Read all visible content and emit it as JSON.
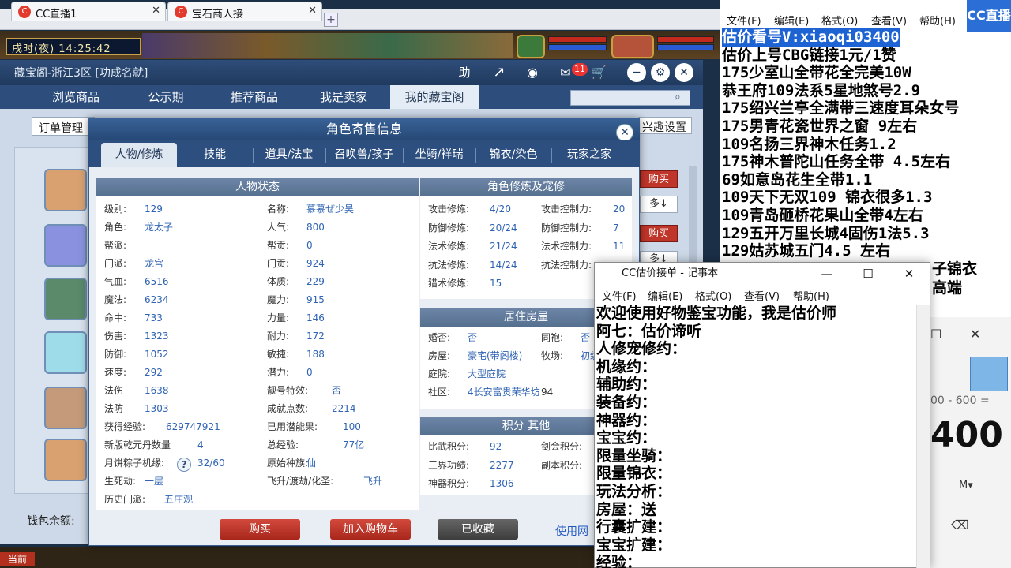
{
  "browser": {
    "tabs": [
      {
        "label": "CC直播1",
        "close": "✕"
      },
      {
        "label": "宝石商人接",
        "close": "✕"
      }
    ],
    "new_tab": "+"
  },
  "game": {
    "clock": "戌时(夜) 14:25:42",
    "window_title": "藏宝阁-浙江3区 [功成名就]",
    "titlebar": {
      "help_label": "助",
      "badge_count": "11"
    },
    "nav_tabs": [
      "浏览商品",
      "公示期",
      "推荐商品",
      "我是卖家",
      "我的藏宝阁"
    ],
    "active_nav": "我的藏宝阁",
    "sub_left": "订单管理",
    "sub_right": "兴趣设置",
    "buy_label": "购买",
    "more_label": "多↓",
    "wallet_label": "钱包余额:",
    "bottom_left": "当前"
  },
  "modal": {
    "title": "角色寄售信息",
    "close": "✕",
    "tabs": [
      "人物/修炼",
      "技能",
      "道具/法宝",
      "召唤兽/孩子",
      "坐骑/祥瑞",
      "锦衣/染色",
      "玩家之家"
    ],
    "active_tab": "人物/修炼",
    "status_header": "人物状态",
    "status": [
      {
        "l1": "级别:",
        "v1": "129",
        "l2": "名称:",
        "v2": "慕慕ぜ少昊"
      },
      {
        "l1": "角色:",
        "v1": "龙太子",
        "l2": "人气:",
        "v2": "800"
      },
      {
        "l1": "帮派:",
        "v1": "",
        "l2": "帮贡:",
        "v2": "0"
      },
      {
        "l1": "门派:",
        "v1": "龙宫",
        "l2": "门贡:",
        "v2": "924"
      },
      {
        "l1": "气血:",
        "v1": "6516",
        "l2": "体质:",
        "v2": "229"
      },
      {
        "l1": "魔法:",
        "v1": "6234",
        "l2": "魔力:",
        "v2": "915"
      },
      {
        "l1": "命中:",
        "v1": "733",
        "l2": "力量:",
        "v2": "146"
      },
      {
        "l1": "伤害:",
        "v1": "1323",
        "l2": "耐力:",
        "v2": "172"
      },
      {
        "l1": "防御:",
        "v1": "1052",
        "l2": "敏捷:",
        "v2": "188"
      },
      {
        "l1": "速度:",
        "v1": "292",
        "l2": "潜力:",
        "v2": "0"
      },
      {
        "l1": "法伤",
        "v1": "1638",
        "l2": "靓号特效:",
        "v2": "否"
      },
      {
        "l1": "法防",
        "v1": "1303",
        "l2": "成就点数:",
        "v2": "2214"
      },
      {
        "l1": "获得经验:",
        "v1": "629747921",
        "l2": "已用潜能果:",
        "v2": "100"
      },
      {
        "l1": "新版乾元丹数量",
        "v1": "4",
        "l2": "总经验:",
        "v2": "77亿"
      },
      {
        "l1": "月饼粽子机缘:",
        "v1": "32/60",
        "l2": "原始种族:",
        "v2": "仙"
      },
      {
        "l1": "生死劫:",
        "v1": "一层",
        "l2": "飞升/渡劫/化圣:",
        "v2": "飞升"
      },
      {
        "l1": "历史门派:",
        "v1": "五庄观",
        "l2": "",
        "v2": ""
      }
    ],
    "help_q": "?",
    "cultivation_header": "角色修炼及宠修",
    "cultivation": [
      {
        "l1": "攻击修炼:",
        "v1": "4/20",
        "l2": "攻击控制力:",
        "v2": "20"
      },
      {
        "l1": "防御修炼:",
        "v1": "20/24",
        "l2": "防御控制力:",
        "v2": "7"
      },
      {
        "l1": "法术修炼:",
        "v1": "21/24",
        "l2": "法术控制力:",
        "v2": "11"
      },
      {
        "l1": "抗法修炼:",
        "v1": "14/24",
        "l2": "抗法控制力:",
        "v2": ""
      },
      {
        "l1": "猎术修炼:",
        "v1": "15",
        "l2": "",
        "v2": ""
      }
    ],
    "house_header": "居住房屋",
    "house": [
      {
        "l1": "婚否:",
        "v1": "否",
        "l2": "同袍:",
        "v2": "否"
      },
      {
        "l1": "房屋:",
        "v1": "豪宅(带阁楼)",
        "l2": "牧场:",
        "v2": "初级"
      },
      {
        "l1": "庭院:",
        "v1": "大型庭院",
        "l2": "",
        "v2": ""
      },
      {
        "l1": "社区:",
        "v1": "4长安富贵荣华坊",
        "l2": "94",
        "v2": ""
      }
    ],
    "points_header": "积分 其他",
    "points": [
      {
        "l1": "比武积分:",
        "v1": "92",
        "l2": "剑会积分:",
        "v2": ""
      },
      {
        "l1": "三界功绩:",
        "v1": "2277",
        "l2": "副本积分:",
        "v2": ""
      },
      {
        "l1": "神器积分:",
        "v1": "1306",
        "l2": "",
        "v2": ""
      }
    ],
    "buttons": {
      "buy": "购买",
      "cart": "加入购物车",
      "fav": "已收藏",
      "help": "使用网"
    }
  },
  "bg_notepad": {
    "menu": [
      "文件(F)",
      "编辑(E)",
      "格式(O)",
      "查看(V)",
      "帮助(H)"
    ],
    "lines": [
      "估价看号V:xiaoqi03400",
      "估价上号CBG链接1元/1赞",
      "175少室山全带花全完美10W",
      "恭王府109法系5星地煞号2.9",
      "175绍兴兰亭全满带三速度耳朵女号",
      "175男青花瓷世界之窗  9左右",
      "109名扬三界神木任务1.2",
      "175神木普陀山任务全带 4.5左右",
      "69如意岛花生全带1.1",
      "109天下无双109  锦衣很多1.3",
      "109青岛砸桥花果山全带4左右",
      "129五开万里长城4固伤1法5.3",
      "129姑苏城五门4.5 左右"
    ],
    "tail": [
      "子锦衣",
      "高端"
    ],
    "logo": "CC直播"
  },
  "calculator": {
    "expr": "00 - 600 =",
    "result": "400",
    "mem": "M▾",
    "back": "⌫"
  },
  "notepad": {
    "title": "CC估价接单 - 记事本",
    "controls": {
      "min": "—",
      "max": "☐",
      "close": "✕"
    },
    "menu": [
      "文件(F)",
      "编辑(E)",
      "格式(O)",
      "查看(V)",
      "帮助(H)"
    ],
    "lines": [
      "欢迎使用好物鉴宝功能，我是估价师",
      "阿七：估价谛听",
      "人修宠修约：",
      "机缘约：",
      "辅助约：",
      "装备约：",
      "神器约：",
      "宝宝约：",
      "限量坐骑：",
      "限量锦衣：",
      "玩法分析：",
      "房屋：送",
      "行囊扩建：",
      "宝宝扩建：",
      "经验："
    ]
  }
}
